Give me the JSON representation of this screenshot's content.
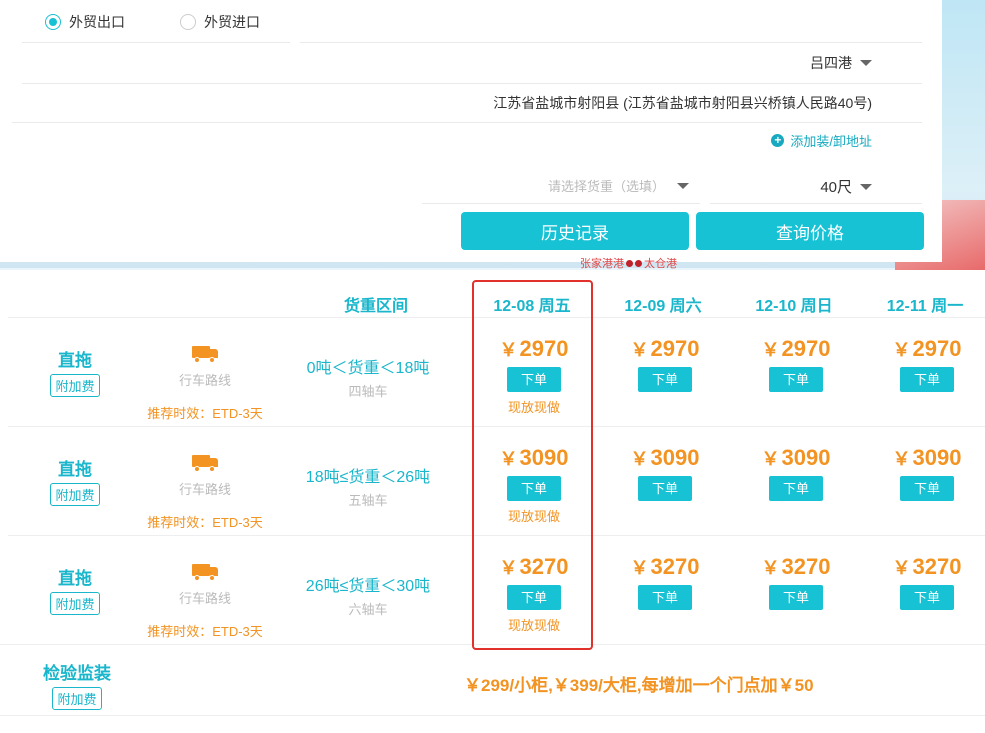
{
  "trade_type": {
    "options": [
      {
        "label": "外贸出口",
        "checked": true
      },
      {
        "label": "外贸进口",
        "checked": false
      }
    ]
  },
  "form": {
    "port": "吕四港",
    "address": "江苏省盐城市射阳县 (江苏省盐城市射阳县兴桥镇人民路40号)",
    "add_address": "添加装/卸地址",
    "weight_placeholder": "请选择货重（选填）",
    "container": "40尺",
    "history_button": "历史记录",
    "query_button": "查询价格"
  },
  "map_label": {
    "text1": "张家港港",
    "text2": "太仓港"
  },
  "table": {
    "headers": {
      "weight_range": "货重区间",
      "dates": [
        "12-08 周五",
        "12-09 周六",
        "12-10 周日",
        "12-11 周一"
      ]
    },
    "rows": [
      {
        "type": "直拖",
        "fee": "附加费",
        "route": "行车路线",
        "eta": "推荐时效：ETD-3天",
        "range": "0吨＜货重＜18吨",
        "axle": "四轴车",
        "prices": [
          "2970",
          "2970",
          "2970",
          "2970"
        ],
        "order": "下单",
        "now_tag": "现放现做"
      },
      {
        "type": "直拖",
        "fee": "附加费",
        "route": "行车路线",
        "eta": "推荐时效：ETD-3天",
        "range": "18吨≤货重＜26吨",
        "axle": "五轴车",
        "prices": [
          "3090",
          "3090",
          "3090",
          "3090"
        ],
        "order": "下单",
        "now_tag": "现放现做"
      },
      {
        "type": "直拖",
        "fee": "附加费",
        "route": "行车路线",
        "eta": "推荐时效：ETD-3天",
        "range": "26吨≤货重＜30吨",
        "axle": "六轴车",
        "prices": [
          "3270",
          "3270",
          "3270",
          "3270"
        ],
        "order": "下单",
        "now_tag": "现放现做"
      }
    ],
    "currency": "￥",
    "inspection": {
      "type": "检验监装",
      "fee": "附加费",
      "note": "￥299/小柜,￥399/大柜,每增加一个门点加￥50"
    }
  },
  "colors": {
    "accent": "#16c2d4",
    "price": "#f29322",
    "highlight": "#e2302b"
  }
}
